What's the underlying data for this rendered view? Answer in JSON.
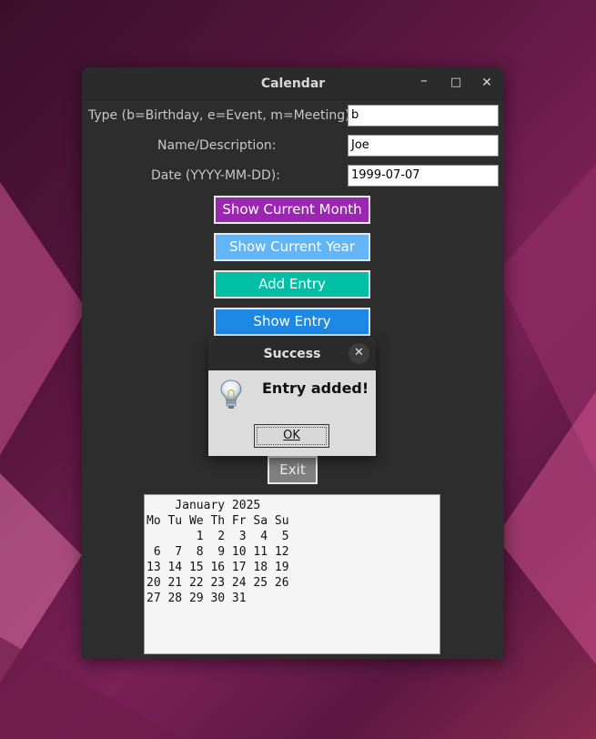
{
  "window": {
    "title": "Calendar",
    "controls": {
      "minimize": "–",
      "maximize": "□",
      "close": "✕"
    }
  },
  "form": {
    "type_label": "Type (b=Birthday, e=Event, m=Meeting):",
    "type_value": "b",
    "name_label": "Name/Description:",
    "name_value": "Joe",
    "date_label": "Date (YYYY-MM-DD):",
    "date_value": "1999-07-07"
  },
  "buttons": {
    "show_month": "Show Current Month",
    "show_year": "Show Current Year",
    "add_entry": "Add Entry",
    "show_entry": "Show Entry",
    "exit": "Exit"
  },
  "calendar_text": "    January 2025\nMo Tu We Th Fr Sa Su\n       1  2  3  4  5\n 6  7  8  9 10 11 12\n13 14 15 16 17 18 19\n20 21 22 23 24 25 26\n27 28 29 30 31",
  "dialog": {
    "title": "Success",
    "close": "✕",
    "icon": "lightbulb-icon",
    "message": "Entry added!",
    "ok_label": "OK"
  },
  "colors": {
    "show_month": "#9b27b0",
    "show_year": "#64b5f6",
    "add_entry": "#00bfa5",
    "show_entry": "#1e88e5",
    "exit": "#808080"
  }
}
